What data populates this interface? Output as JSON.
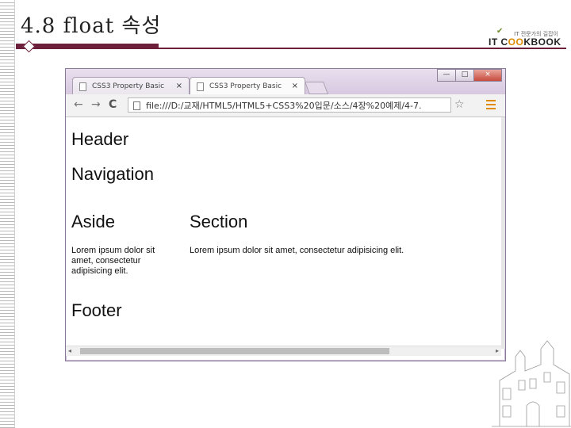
{
  "slide": {
    "title": "4.8 float 속성",
    "brand_small": "IT 전문가의 길잡이",
    "brand_main_prefix": "IT C",
    "brand_main_o": "OO",
    "brand_main_suffix": "KBOOK"
  },
  "browser": {
    "tabs": [
      {
        "label": "CSS3 Property Basic",
        "close": "×"
      },
      {
        "label": "CSS3 Property Basic",
        "close": "×"
      }
    ],
    "window_buttons": {
      "minimize": "—",
      "maximize": "□",
      "close": "×"
    },
    "nav": {
      "back": "←",
      "forward": "→",
      "reload": "C"
    },
    "address": "file:///D:/교재/HTML5/HTML5+CSS3%20입문/소스/4장%20예제/4-7.",
    "star": "☆"
  },
  "page": {
    "header": "Header",
    "navigation": "Navigation",
    "aside_heading": "Aside",
    "aside_text": "Lorem ipsum dolor sit amet, consectetur adipisicing elit.",
    "section_heading": "Section",
    "section_text": "Lorem ipsum dolor sit amet, consectetur adipisicing elit.",
    "footer": "Footer"
  },
  "colors": {
    "accent": "#6b1f3a",
    "brand_orange": "#e08a00"
  }
}
